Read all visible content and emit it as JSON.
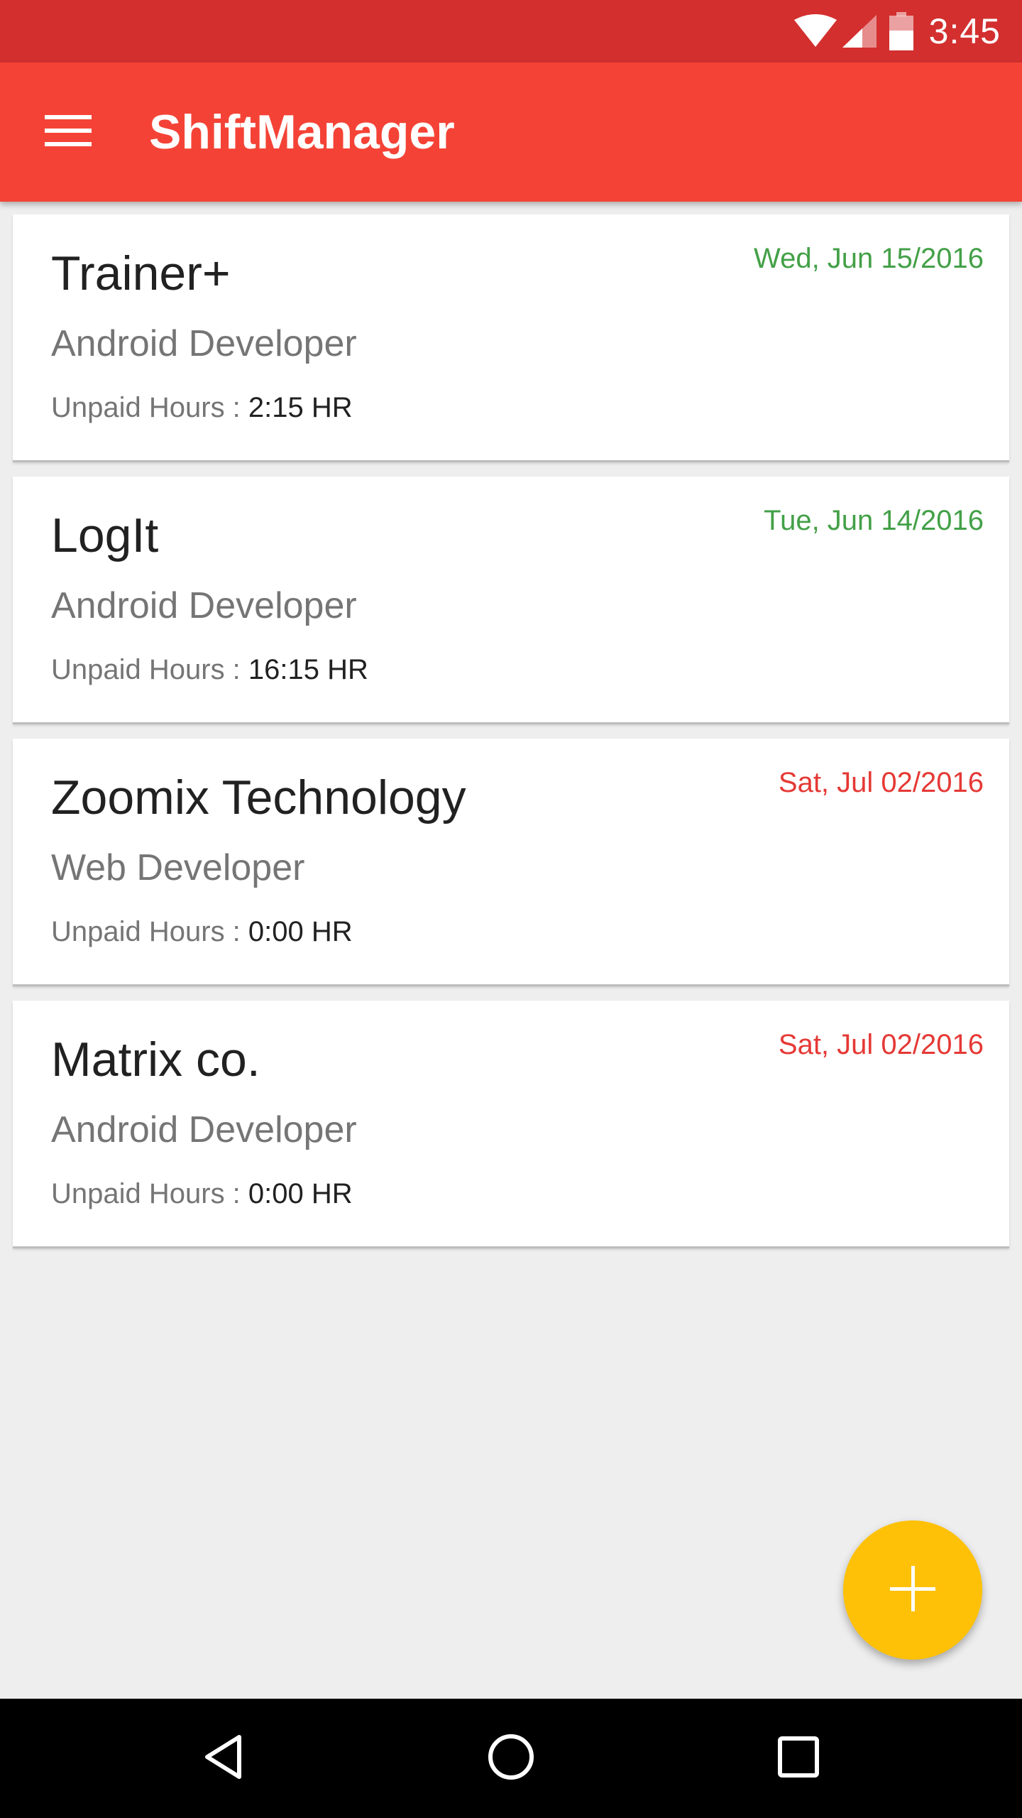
{
  "status_bar": {
    "time": "3:45",
    "icons": [
      "wifi-icon",
      "signal-icon",
      "battery-icon"
    ]
  },
  "app_bar": {
    "title": "ShiftManager",
    "menu_icon": "hamburger-menu-icon"
  },
  "shifts": [
    {
      "company": "Trainer+",
      "role": "Android Developer",
      "hours_label": "Unpaid Hours :",
      "hours_value": "2:15 HR",
      "date": "Wed, Jun 15/2016",
      "date_color": "#43a047"
    },
    {
      "company": "LogIt",
      "role": "Android Developer",
      "hours_label": "Unpaid Hours :",
      "hours_value": "16:15 HR",
      "date": "Tue, Jun 14/2016",
      "date_color": "#43a047"
    },
    {
      "company": "Zoomix Technology",
      "role": "Web Developer",
      "hours_label": "Unpaid Hours :",
      "hours_value": "0:00 HR",
      "date": "Sat, Jul 02/2016",
      "date_color": "#e53935"
    },
    {
      "company": "Matrix co.",
      "role": "Android Developer",
      "hours_label": "Unpaid Hours :",
      "hours_value": "0:00 HR",
      "date": "Sat, Jul 02/2016",
      "date_color": "#e53935"
    }
  ],
  "fab": {
    "icon": "plus-icon"
  },
  "nav_bar": {
    "icons": [
      "back-icon",
      "home-icon",
      "recents-icon"
    ]
  },
  "colors": {
    "status_bar": "#d32f2f",
    "app_bar": "#f44336",
    "fab": "#ffc107",
    "background": "#eeeeee"
  }
}
